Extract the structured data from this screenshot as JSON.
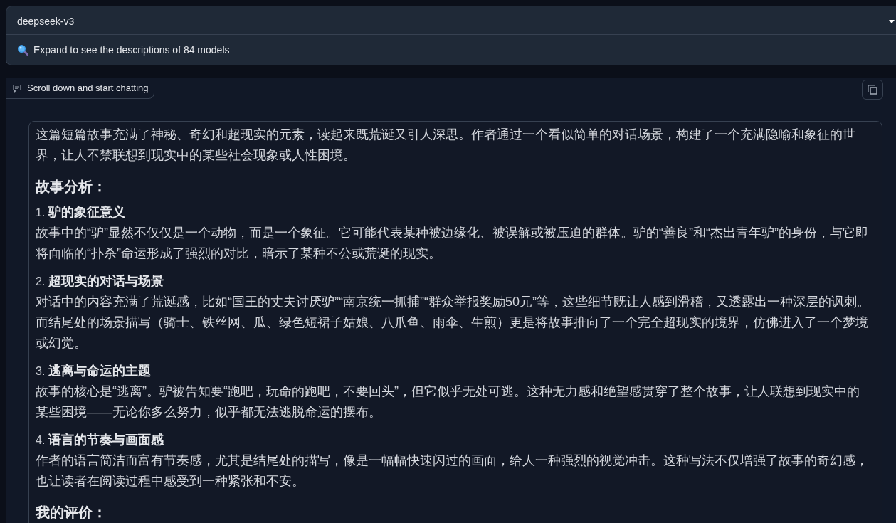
{
  "model_dropdown": {
    "value": "deepseek-v3"
  },
  "accordion": {
    "label": "Expand to see the descriptions of 84 models"
  },
  "chatbot": {
    "label": "Scroll down and start chatting",
    "messages": [
      {
        "blocks": [
          {
            "kind": "paragraph",
            "text": "这篇短篇故事充满了神秘、奇幻和超现实的元素，读起来既荒诞又引人深思。作者通过一个看似简单的对话场景，构建了一个充满隐喻和象征的世界，让人不禁联想到现实中的某些社会现象或人性困境。"
          },
          {
            "kind": "heading",
            "text": "故事分析："
          },
          {
            "kind": "list_item",
            "number": "1.",
            "title": "驴的象征意义",
            "text": "故事中的“驴”显然不仅仅是一个动物，而是一个象征。它可能代表某种被边缘化、被误解或被压迫的群体。驴的“善良”和“杰出青年驴”的身份，与它即将面临的“扑杀”命运形成了强烈的对比，暗示了某种不公或荒诞的现实。"
          },
          {
            "kind": "list_item",
            "number": "2.",
            "title": "超现实的对话与场景",
            "text": "对话中的内容充满了荒诞感，比如“国王的丈夫讨厌驴”“南京统一抓捕”“群众举报奖励50元”等，这些细节既让人感到滑稽，又透露出一种深层的讽刺。而结尾处的场景描写（骑士、铁丝网、瓜、绿色短裙子姑娘、八爪鱼、雨伞、生煎）更是将故事推向了一个完全超现实的境界，仿佛进入了一个梦境或幻觉。"
          },
          {
            "kind": "list_item",
            "number": "3.",
            "title": "逃离与命运的主题",
            "text": "故事的核心是“逃离”。驴被告知要“跑吧，玩命的跑吧，不要回头”，但它似乎无处可逃。这种无力感和绝望感贯穿了整个故事，让人联想到现实中的某些困境——无论你多么努力，似乎都无法逃脱命运的摆布。"
          },
          {
            "kind": "list_item",
            "number": "4.",
            "title": "语言的节奏与画面感",
            "text": "作者的语言简洁而富有节奏感，尤其是结尾处的描写，像是一幅幅快速闪过的画面，给人一种强烈的视觉冲击。这种写法不仅增强了故事的奇幻感，也让读者在阅读过程中感受到一种紧张和不安。"
          },
          {
            "kind": "heading",
            "text": "我的评价："
          }
        ]
      }
    ]
  }
}
